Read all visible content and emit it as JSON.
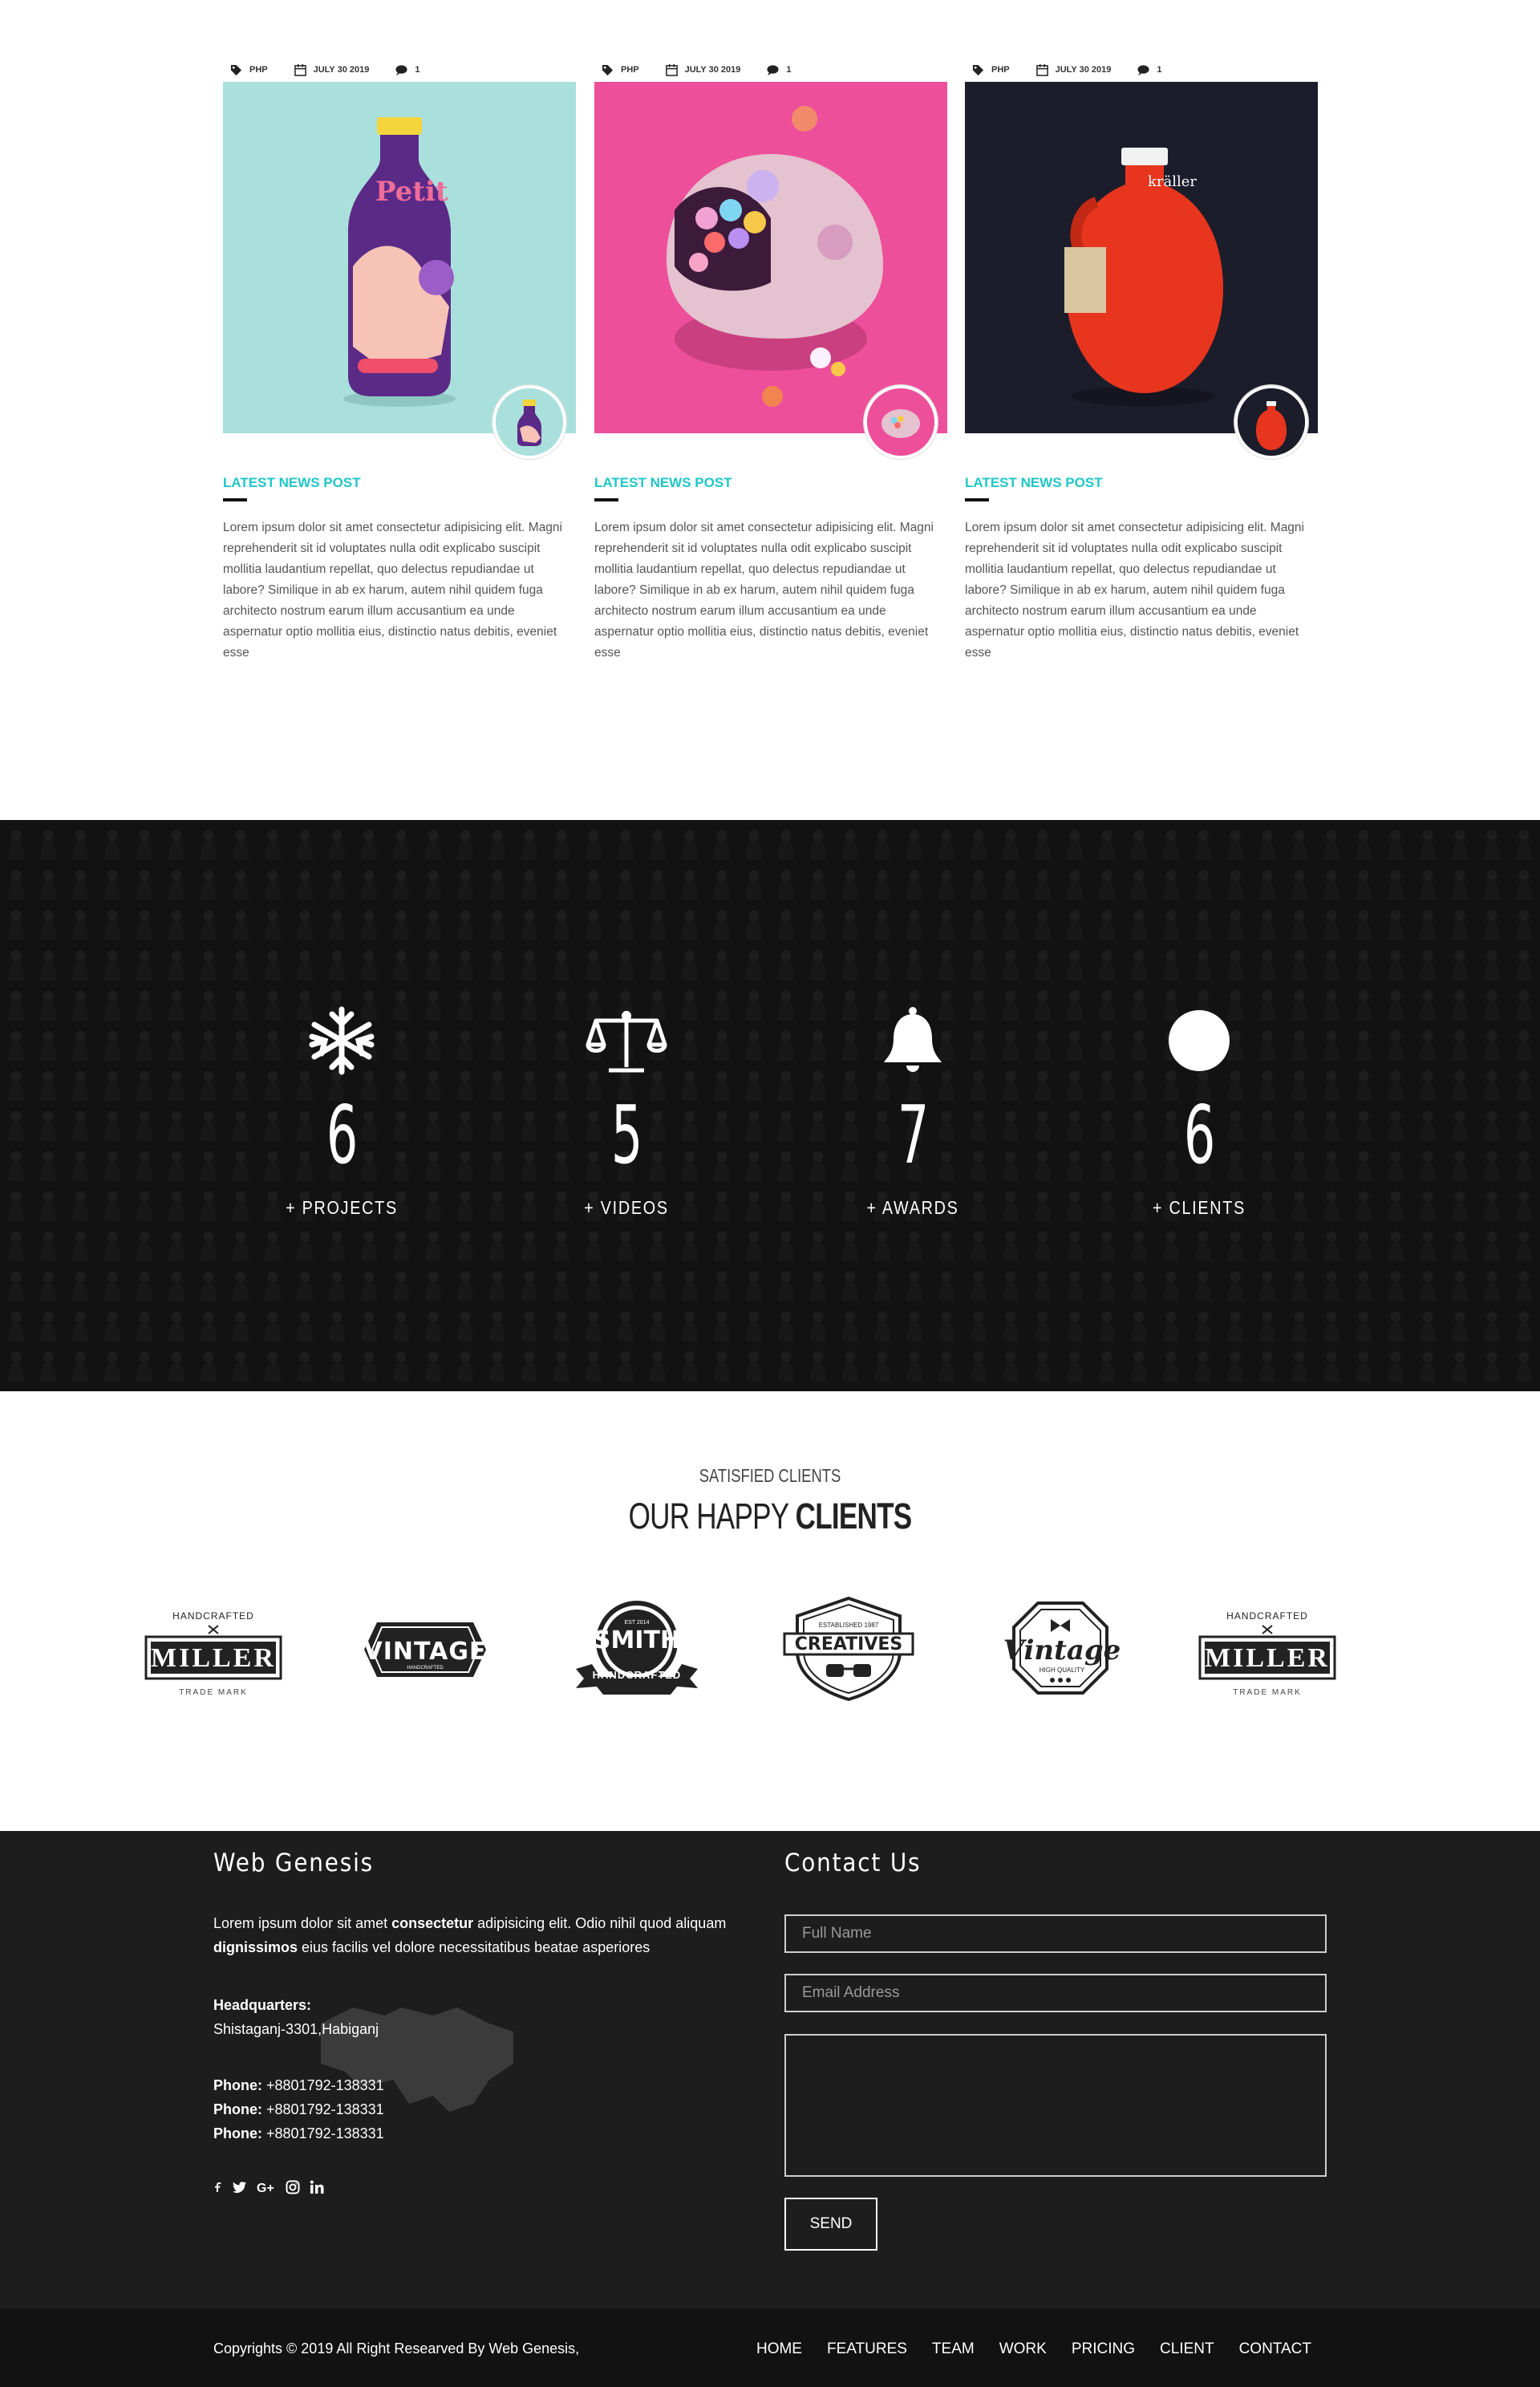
{
  "posts": [
    {
      "tag": "PHP",
      "date": "JULY 30 2019",
      "comments": "1",
      "title": "LATEST NEWS POST",
      "body": "Lorem ipsum dolor sit amet consectetur adipisicing elit. Magni reprehenderit sit id voluptates nulla odit explicabo suscipit mollitia laudantium repellat, quo delectus repudiandae ut labore? Similique in ab ex harum, autem nihil quidem fuga architecto nostrum earum illum accusantium ea unde aspernatur optio mollitia eius, distinctio natus debitis, eveniet esse",
      "image_bg": "#a9e0dc",
      "image_subject": "juice-bottle"
    },
    {
      "tag": "PHP",
      "date": "JULY 30 2019",
      "comments": "1",
      "title": "LATEST NEWS POST",
      "body": "Lorem ipsum dolor sit amet consectetur adipisicing elit. Magni reprehenderit sit id voluptates nulla odit explicabo suscipit mollitia laudantium repellat, quo delectus repudiandae ut labore? Similique in ab ex harum, autem nihil quidem fuga architecto nostrum earum illum accusantium ea unde aspernatur optio mollitia eius, distinctio natus debitis, eveniet esse",
      "image_bg": "#ee4f9a",
      "image_subject": "gumball-helmet"
    },
    {
      "tag": "PHP",
      "date": "JULY 30 2019",
      "comments": "1",
      "title": "LATEST NEWS POST",
      "body": "Lorem ipsum dolor sit amet consectetur adipisicing elit. Magni reprehenderit sit id voluptates nulla odit explicabo suscipit mollitia laudantium repellat, quo delectus repudiandae ut labore? Similique in ab ex harum, autem nihil quidem fuga architecto nostrum earum illum accusantium ea unde aspernatur optio mollitia eius, distinctio natus debitis, eveniet esse",
      "image_bg": "#1c1d2b",
      "image_subject": "red-jug"
    }
  ],
  "stats": [
    {
      "icon": "snowflake-icon",
      "value": "6",
      "label": "+ PROJECTS"
    },
    {
      "icon": "balance-scale-icon",
      "value": "5",
      "label": "+ VIDEOS"
    },
    {
      "icon": "bell-icon",
      "value": "7",
      "label": "+ AWARDS"
    },
    {
      "icon": "circle-icon",
      "value": "6",
      "label": "+ CLIENTS"
    }
  ],
  "clients": {
    "subtitle": "SATISFIED CLIENTS",
    "title_light": "OUR HAPPY ",
    "title_bold": "CLIENTS",
    "logos": [
      {
        "name": "MILLER",
        "top": "HANDCRAFTED",
        "bottom": "TRADE MARK"
      },
      {
        "name": "VINTAGE",
        "top": "",
        "bottom": "HANDCRAFTED"
      },
      {
        "name": "SMITH",
        "top": "EST 2014",
        "bottom": "HANDCRAFTED"
      },
      {
        "name": "CREATIVES",
        "top": "ESTABLISHED 1987",
        "bottom": ""
      },
      {
        "name": "Vintage",
        "top": "",
        "bottom": "HIGH QUALITY"
      },
      {
        "name": "MILLER",
        "top": "HANDCRAFTED",
        "bottom": "TRADE MARK"
      }
    ]
  },
  "footer": {
    "brand": "Web Genesis",
    "about_1": "Lorem ipsum dolor sit amet ",
    "about_b1": "consectetur",
    "about_2": " adipisicing elit. Odio nihil quod aliquam",
    "about_b2": "dignissimos",
    "about_3": " eius facilis vel dolore necessitatibus beatae asperiores",
    "hq_label": "Headquarters:",
    "hq_value": "Shistaganj-3301,Habiganj",
    "phone_label": "Phone:",
    "phones": [
      "+8801792-138331",
      "+8801792-138331",
      "+8801792-138331"
    ],
    "social": [
      "facebook-icon",
      "twitter-icon",
      "google-plus-icon",
      "instagram-icon",
      "linkedin-icon"
    ],
    "contact_title": "Contact Us",
    "name_placeholder": "Full Name",
    "email_placeholder": "Email Address",
    "send_label": "SEND"
  },
  "bottom": {
    "copyright": "Copyrights © 2019 All Right Researved By Web Genesis,",
    "nav": [
      "HOME",
      "FEATURES",
      "TEAM",
      "WORK",
      "PRICING",
      "CLIENT",
      "CONTACT"
    ]
  }
}
